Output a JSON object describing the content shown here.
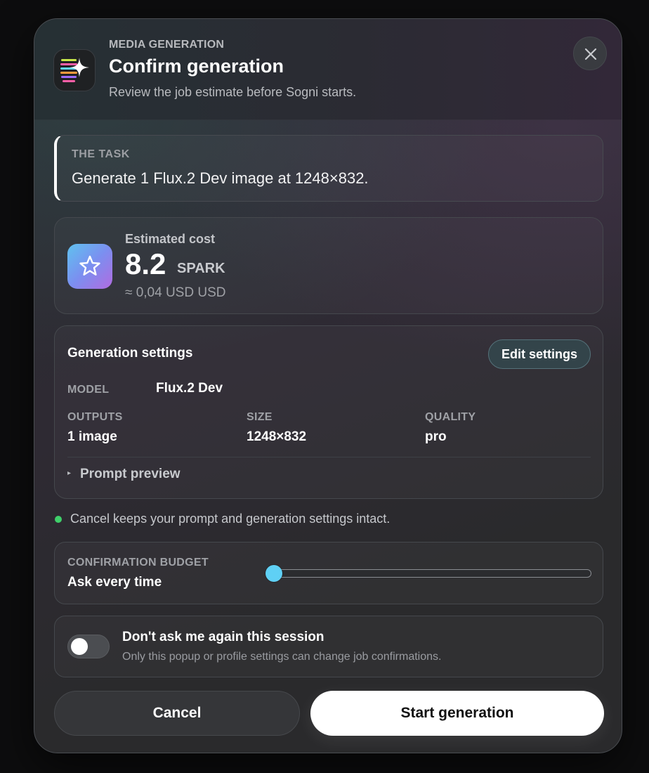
{
  "header": {
    "eyebrow": "MEDIA GENERATION",
    "title": "Confirm generation",
    "subtitle": "Review the job estimate before Sogni starts.",
    "app_icon": "sogni-logo-icon",
    "close_icon": "close-icon"
  },
  "task": {
    "label": "THE TASK",
    "text": "Generate 1 Flux.2 Dev image at 1248×832."
  },
  "cost": {
    "label": "Estimated cost",
    "value": "8.2",
    "unit": "SPARK",
    "fiat": "≈ 0,04 USD USD",
    "icon": "star-icon"
  },
  "settings": {
    "title": "Generation settings",
    "edit_label": "Edit settings",
    "model": {
      "key": "MODEL",
      "value": "Flux.2 Dev"
    },
    "outputs": {
      "key": "OUTPUTS",
      "value": "1 image"
    },
    "size": {
      "key": "SIZE",
      "value": "1248×832"
    },
    "quality": {
      "key": "QUALITY",
      "value": "pro"
    },
    "prompt_preview": {
      "caret": "▸",
      "label": "Prompt preview"
    }
  },
  "notice": {
    "text": "Cancel keeps your prompt and generation settings intact.",
    "dot_color": "#3fcf6a"
  },
  "budget": {
    "label": "CONFIRMATION BUDGET",
    "value": "Ask every time",
    "slider_level": 0,
    "thumb_color": "#5fd0f5"
  },
  "session": {
    "title": "Don't ask me again this session",
    "subtitle": "Only this popup or profile settings can change job confirmations.",
    "toggle_on": false
  },
  "actions": {
    "cancel_label": "Cancel",
    "start_label": "Start generation"
  }
}
